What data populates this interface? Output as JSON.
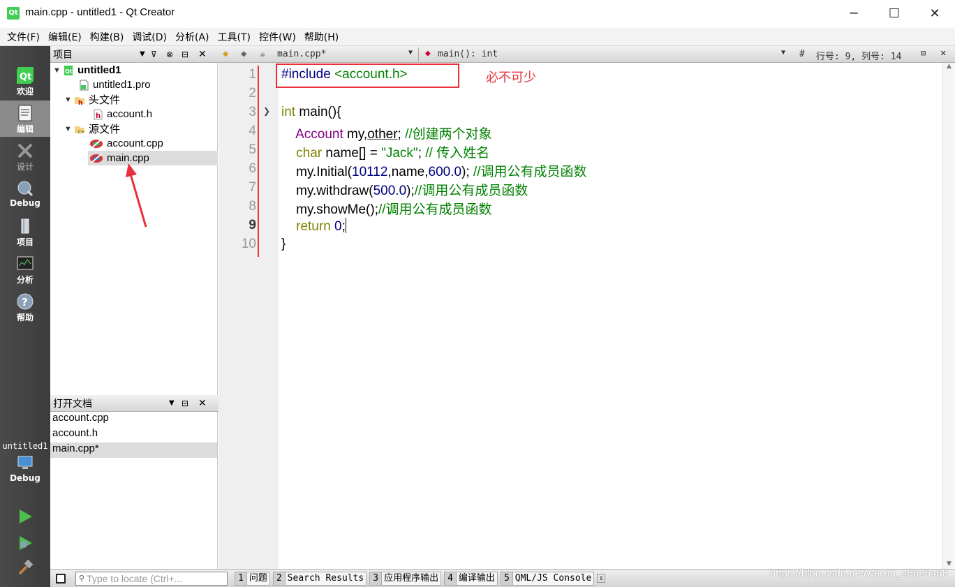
{
  "window": {
    "title": "main.cpp - untitled1 - Qt Creator",
    "minimize_glyph": "─",
    "maximize_glyph": "☐",
    "close_glyph": "✕"
  },
  "menu": [
    "文件(F)",
    "编辑(E)",
    "构建(B)",
    "调试(D)",
    "分析(A)",
    "工具(T)",
    "控件(W)",
    "帮助(H)"
  ],
  "modes": [
    {
      "label": "欢迎",
      "icon": "qt-logo-icon"
    },
    {
      "label": "编辑",
      "icon": "edit-document-icon"
    },
    {
      "label": "设计",
      "icon": "design-pencil-icon"
    },
    {
      "label": "Debug",
      "icon": "debug-bug-icon"
    },
    {
      "label": "项目",
      "icon": "project-wrench-icon"
    },
    {
      "label": "分析",
      "icon": "analyze-monitor-icon"
    },
    {
      "label": "帮助",
      "icon": "help-question-icon"
    }
  ],
  "kit": {
    "project": "untitled1",
    "config": "Debug"
  },
  "project_panel": {
    "title": "项目",
    "tree": [
      {
        "label": "untitled1",
        "level": 0,
        "icon": "qt-project-icon",
        "expanded": true
      },
      {
        "label": "untitled1.pro",
        "level": 1,
        "icon": "pro-file-icon"
      },
      {
        "label": "头文件",
        "level": 1,
        "icon": "header-folder-icon",
        "expanded": true
      },
      {
        "label": "account.h",
        "level": 2,
        "icon": "header-file-icon"
      },
      {
        "label": "源文件",
        "level": 1,
        "icon": "source-folder-icon",
        "expanded": true
      },
      {
        "label": "account.cpp",
        "level": 2,
        "icon": "cpp-file-icon"
      },
      {
        "label": "main.cpp",
        "level": 2,
        "icon": "cpp-file-icon",
        "selected": true
      }
    ]
  },
  "open_docs": {
    "title": "打开文档",
    "items": [
      {
        "label": "account.cpp"
      },
      {
        "label": "account.h"
      },
      {
        "label": "main.cpp*",
        "selected": true
      }
    ]
  },
  "editor_toolbar": {
    "file": "main.cpp*",
    "symbol": "main(): int",
    "hash": "#",
    "position": "行号: 9, 列号: 14"
  },
  "editor": {
    "line_numbers": [
      "1",
      "2",
      "3",
      "4",
      "5",
      "6",
      "7",
      "8",
      "9",
      "10"
    ],
    "current_line": 9,
    "lines": [
      [
        {
          "t": "#include ",
          "c": "pp"
        },
        {
          "t": "<account.h>",
          "c": "str"
        }
      ],
      [],
      [
        {
          "t": "int",
          "c": "kw"
        },
        {
          "t": " main(){",
          "c": ""
        }
      ],
      [
        {
          "t": "    ",
          "c": ""
        },
        {
          "t": "Account",
          "c": "ty"
        },
        {
          "t": " my,",
          "c": ""
        },
        {
          "t": "other",
          "c": "u"
        },
        {
          "t": "; ",
          "c": ""
        },
        {
          "t": "//创建两个对象",
          "c": "cm"
        }
      ],
      [
        {
          "t": "    ",
          "c": ""
        },
        {
          "t": "char",
          "c": "kw"
        },
        {
          "t": " name[] = ",
          "c": ""
        },
        {
          "t": "\"Jack\"",
          "c": "str"
        },
        {
          "t": "; ",
          "c": ""
        },
        {
          "t": "// 传入姓名",
          "c": "cm"
        }
      ],
      [
        {
          "t": "    my.Initial(",
          "c": ""
        },
        {
          "t": "10112",
          "c": "num"
        },
        {
          "t": ",name,",
          "c": ""
        },
        {
          "t": "600.0",
          "c": "num"
        },
        {
          "t": "); ",
          "c": ""
        },
        {
          "t": "//调用公有成员函数",
          "c": "cm"
        }
      ],
      [
        {
          "t": "    my.withdraw(",
          "c": ""
        },
        {
          "t": "500.0",
          "c": "num"
        },
        {
          "t": ");",
          "c": ""
        },
        {
          "t": "//调用公有成员函数",
          "c": "cm"
        }
      ],
      [
        {
          "t": "    my.showMe();",
          "c": ""
        },
        {
          "t": "//调用公有成员函数",
          "c": "cm"
        }
      ],
      [
        {
          "t": "    ",
          "c": ""
        },
        {
          "t": "return",
          "c": "kw"
        },
        {
          "t": " ",
          "c": ""
        },
        {
          "t": "0",
          "c": "num"
        },
        {
          "t": ";",
          "c": ""
        },
        {
          "t": "",
          "c": "caret"
        }
      ],
      [
        {
          "t": "}",
          "c": ""
        }
      ]
    ]
  },
  "annotation": {
    "text": "必不可少",
    "color": "#e8303a"
  },
  "statusbar": {
    "locator_placeholder": "Type to locate (Ctrl+...",
    "panes": [
      {
        "num": "1",
        "label": "问题"
      },
      {
        "num": "2",
        "label": "Search Results"
      },
      {
        "num": "3",
        "label": "应用程序输出"
      },
      {
        "num": "4",
        "label": "编译输出"
      },
      {
        "num": "5",
        "label": "QML/JS Console"
      }
    ]
  },
  "watermark": "https://blog.csdn.net/weixin_45626468",
  "colors": {
    "keyword": "#808000",
    "type": "#800080",
    "number": "#000080",
    "string": "#008000",
    "comment": "#008000",
    "annotation": "#e8303a"
  }
}
